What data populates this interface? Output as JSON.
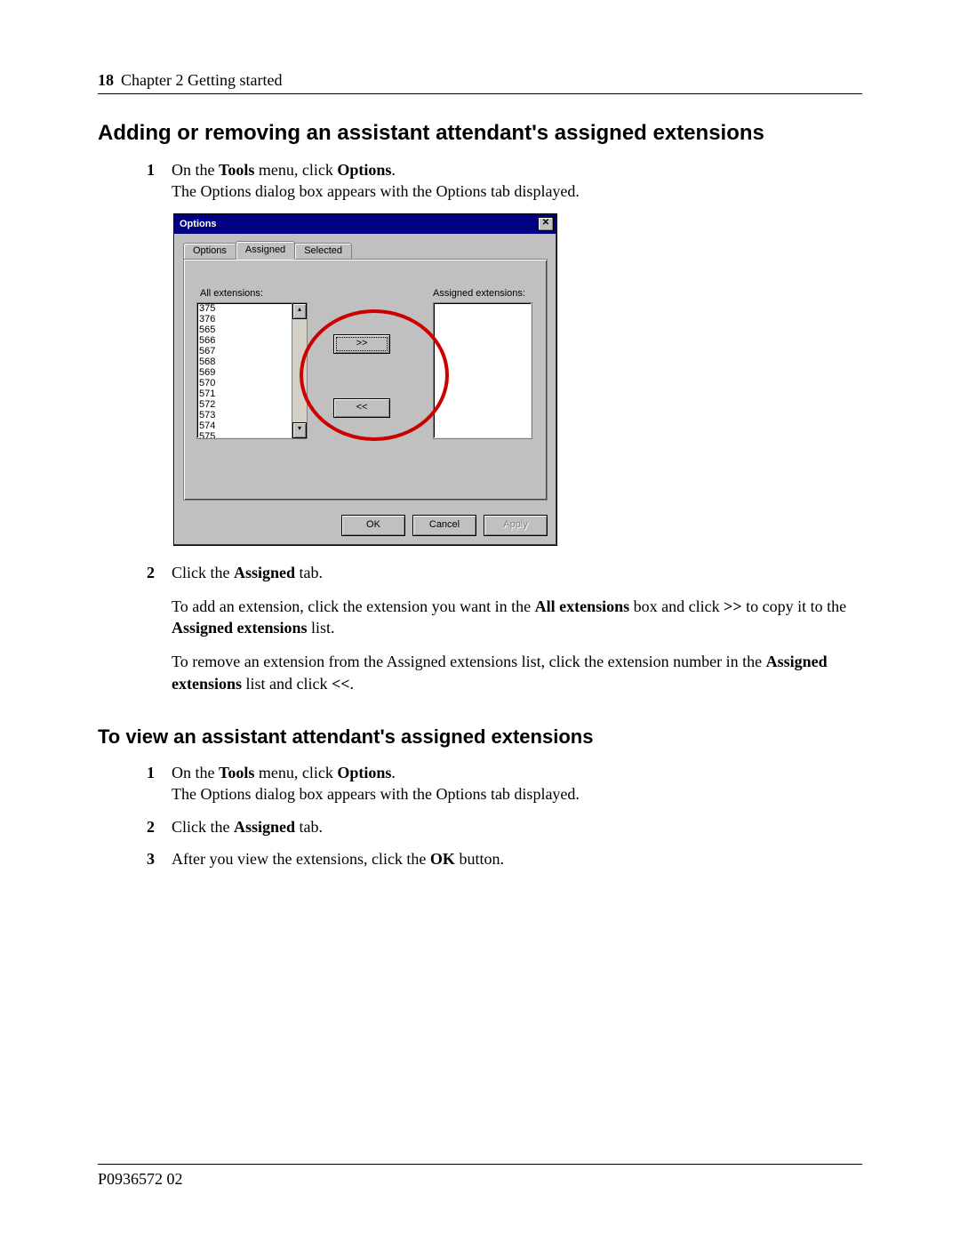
{
  "header": {
    "page_number": "18",
    "chapter": "Chapter 2  Getting started"
  },
  "heading1": "Adding or removing an assistant attendant's assigned extensions",
  "section1": {
    "step1": {
      "num": "1",
      "line1_a": "On the ",
      "line1_tools": "Tools",
      "line1_b": " menu, click ",
      "line1_options": "Options",
      "line1_c": ".",
      "line2": "The Options dialog box appears with the Options tab displayed."
    },
    "step2": {
      "num": "2",
      "line1_a": "Click the ",
      "line1_b": "Assigned",
      "line1_c": " tab.",
      "p2_a": "To add an extension, click the extension you want in the ",
      "p2_b": "All extensions",
      "p2_c": " box and click ",
      "p2_d": ">>",
      "p2_e": " to copy it to the ",
      "p2_f": "Assigned extensions",
      "p2_g": " list.",
      "p3_a": "To remove an extension from the Assigned extensions list, click the extension number in the ",
      "p3_b": "Assigned extensions",
      "p3_c": " list and click ",
      "p3_d": "<<",
      "p3_e": "."
    }
  },
  "heading2": "To view an assistant attendant's assigned extensions",
  "section2": {
    "step1": {
      "num": "1",
      "line1_a": "On the ",
      "line1_tools": "Tools",
      "line1_b": " menu, click ",
      "line1_options": "Options",
      "line1_c": ".",
      "line2": "The Options dialog box appears with the Options tab displayed."
    },
    "step2": {
      "num": "2",
      "a": "Click the ",
      "b": "Assigned",
      "c": " tab."
    },
    "step3": {
      "num": "3",
      "a": "After you view the extensions, click the ",
      "b": "OK",
      "c": " button."
    }
  },
  "dialog": {
    "title": "Options",
    "close": "✕",
    "tabs": {
      "options": "Options",
      "assigned": "Assigned",
      "selected": "Selected"
    },
    "all_label": "All extensions:",
    "assigned_label": "Assigned extensions:",
    "items": [
      "375",
      "376",
      "565",
      "566",
      "567",
      "568",
      "569",
      "570",
      "571",
      "572",
      "573",
      "574",
      "575"
    ],
    "scroll_up": "▴",
    "scroll_down": "▾",
    "btn_add": ">>",
    "btn_remove": "<<",
    "ok": "OK",
    "cancel": "Cancel",
    "apply": "Apply"
  },
  "footer": "P0936572 02"
}
